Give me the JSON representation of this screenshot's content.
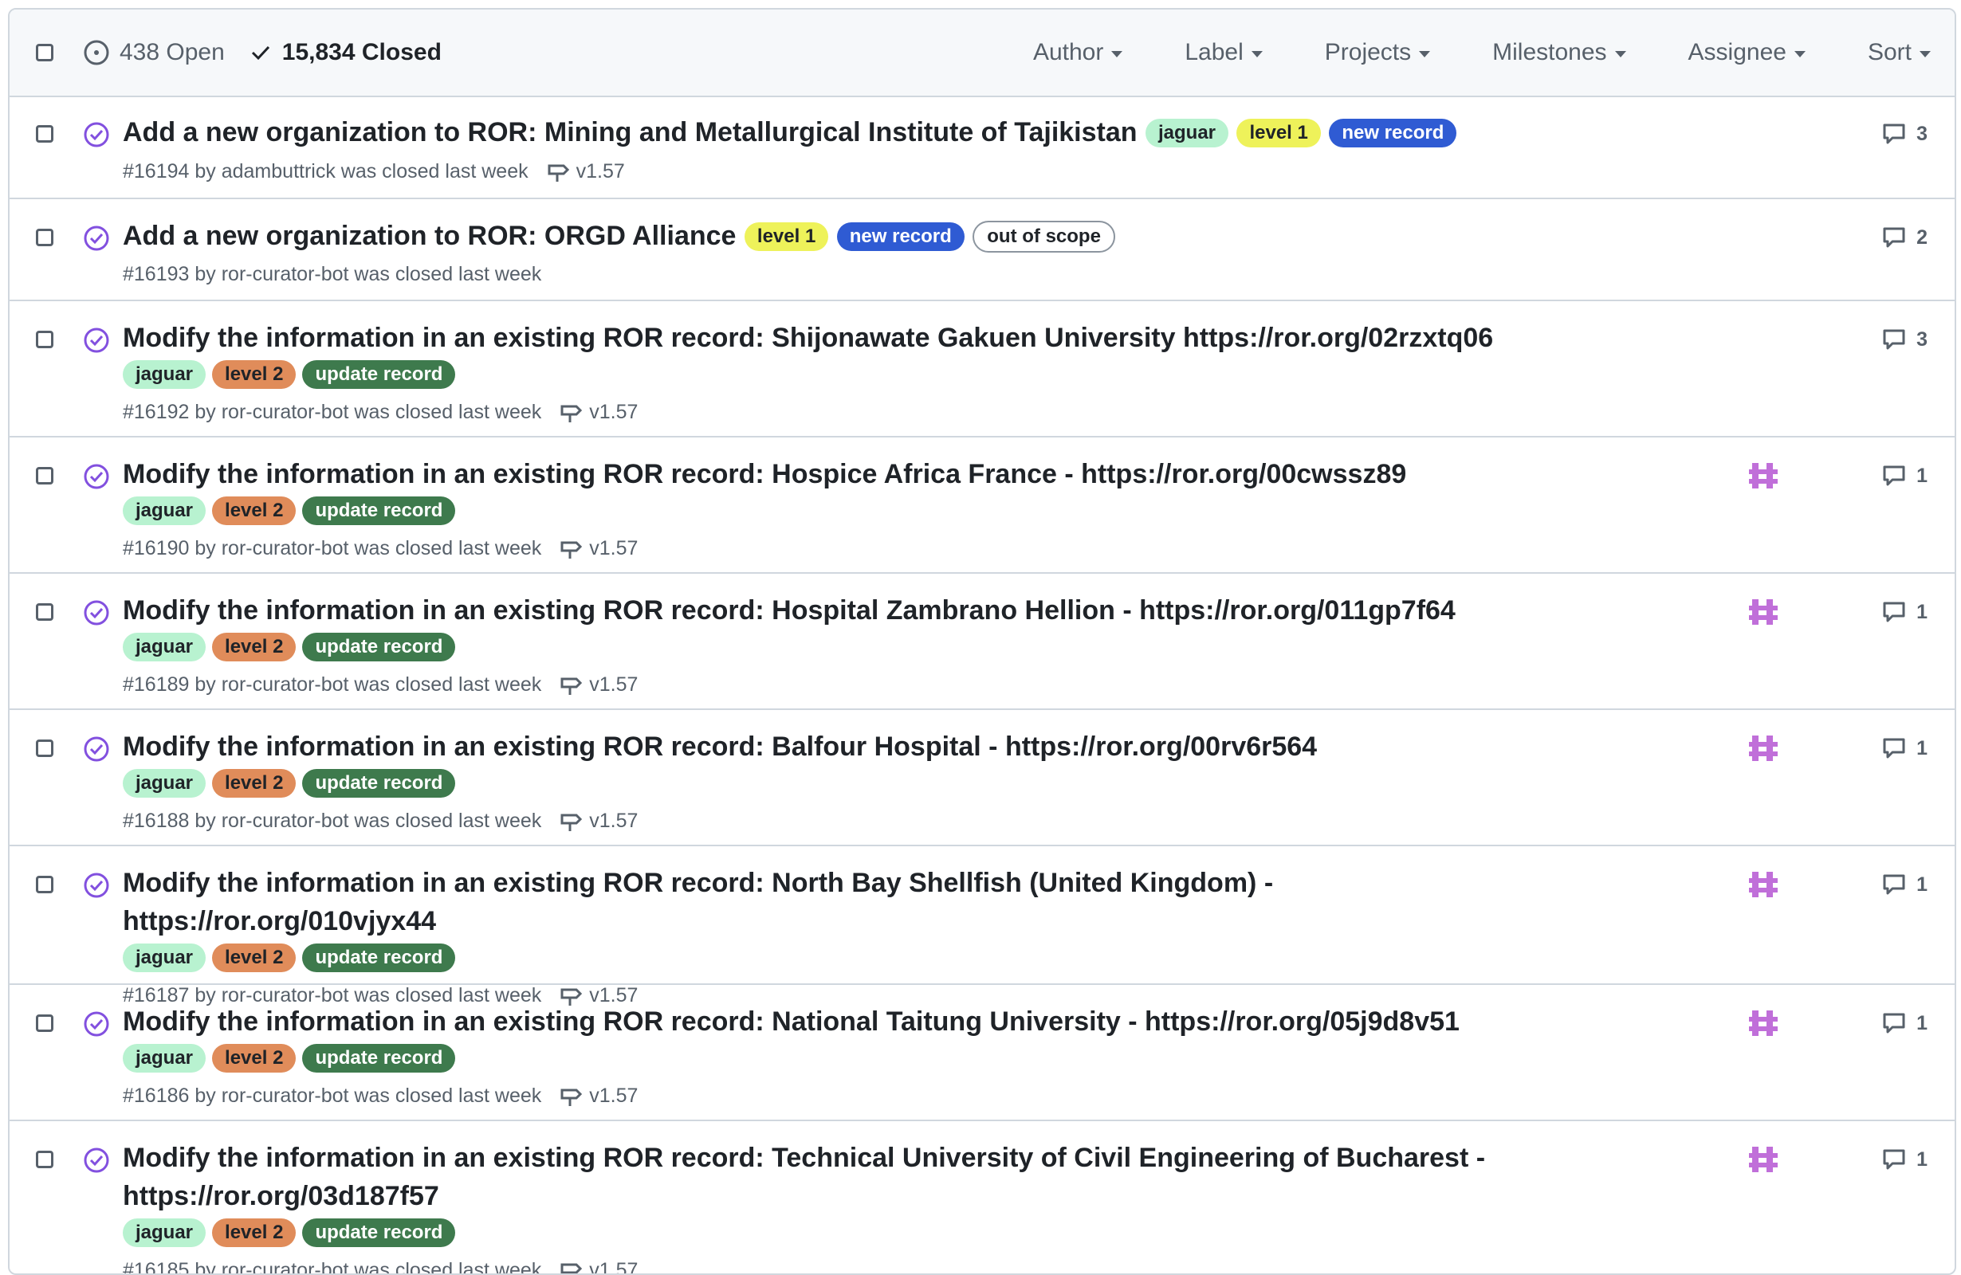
{
  "header": {
    "open_count": "438 Open",
    "closed_count": "15,834 Closed",
    "filters": [
      "Author",
      "Label",
      "Projects",
      "Milestones",
      "Assignee",
      "Sort"
    ]
  },
  "labels_style": {
    "jaguar": {
      "bg": "#b8f2d0",
      "fg": "#1f2328"
    },
    "level 1": {
      "bg": "#eef25a",
      "fg": "#1f2328"
    },
    "level 2": {
      "bg": "#e08c5a",
      "fg": "#1f2328"
    },
    "new record": {
      "bg": "#2f5bd3",
      "fg": "#ffffff"
    },
    "update record": {
      "bg": "#3e7a4d",
      "fg": "#ffffff"
    },
    "out of scope": {
      "bg": "#ffffff",
      "fg": "#1f2328",
      "border": "#8c959f"
    }
  },
  "issues": [
    {
      "title": "Add a new organization to ROR: Mining and Metallurgical Institute of Tajikistan",
      "labels": [
        "jaguar",
        "level 1",
        "new record"
      ],
      "meta": "#16194 by adambuttrick was closed last week",
      "milestone": "v1.57",
      "comments": "3",
      "has_avatar": false
    },
    {
      "title": "Add a new organization to ROR: ORGD Alliance",
      "labels": [
        "level 1",
        "new record",
        "out of scope"
      ],
      "meta": "#16193 by ror-curator-bot was closed last week",
      "milestone": "",
      "comments": "2",
      "has_avatar": false
    },
    {
      "title": "Modify the information in an existing ROR record: Shijonawate Gakuen University https://ror.org/02rzxtq06",
      "labels": [
        "jaguar",
        "level 2",
        "update record"
      ],
      "meta": "#16192 by ror-curator-bot was closed last week",
      "milestone": "v1.57",
      "comments": "3",
      "has_avatar": false
    },
    {
      "title": "Modify the information in an existing ROR record: Hospice Africa France - https://ror.org/00cwssz89",
      "labels": [
        "jaguar",
        "level 2",
        "update record"
      ],
      "meta": "#16190 by ror-curator-bot was closed last week",
      "milestone": "v1.57",
      "comments": "1",
      "has_avatar": true
    },
    {
      "title": "Modify the information in an existing ROR record: Hospital Zambrano Hellion - https://ror.org/011gp7f64",
      "labels": [
        "jaguar",
        "level 2",
        "update record"
      ],
      "meta": "#16189 by ror-curator-bot was closed last week",
      "milestone": "v1.57",
      "comments": "1",
      "has_avatar": true
    },
    {
      "title": "Modify the information in an existing ROR record: Balfour Hospital - https://ror.org/00rv6r564",
      "labels": [
        "jaguar",
        "level 2",
        "update record"
      ],
      "meta": "#16188 by ror-curator-bot was closed last week",
      "milestone": "v1.57",
      "comments": "1",
      "has_avatar": true
    },
    {
      "title": "Modify the information in an existing ROR record: North Bay Shellfish (United Kingdom) - https://ror.org/010vjyx44",
      "labels": [
        "jaguar",
        "level 2",
        "update record"
      ],
      "meta": "#16187 by ror-curator-bot was closed last week",
      "milestone": "v1.57",
      "comments": "1",
      "has_avatar": true
    },
    {
      "title": "Modify the information in an existing ROR record: National Taitung University - https://ror.org/05j9d8v51",
      "labels": [
        "jaguar",
        "level 2",
        "update record"
      ],
      "meta": "#16186 by ror-curator-bot was closed last week",
      "milestone": "v1.57",
      "comments": "1",
      "has_avatar": true
    },
    {
      "title": "Modify the information in an existing ROR record: Technical University of Civil Engineering of Bucharest - https://ror.org/03d187f57",
      "labels": [
        "jaguar",
        "level 2",
        "update record"
      ],
      "meta": "#16185 by ror-curator-bot was closed last week",
      "milestone": "v1.57",
      "comments": "1",
      "has_avatar": true
    }
  ]
}
